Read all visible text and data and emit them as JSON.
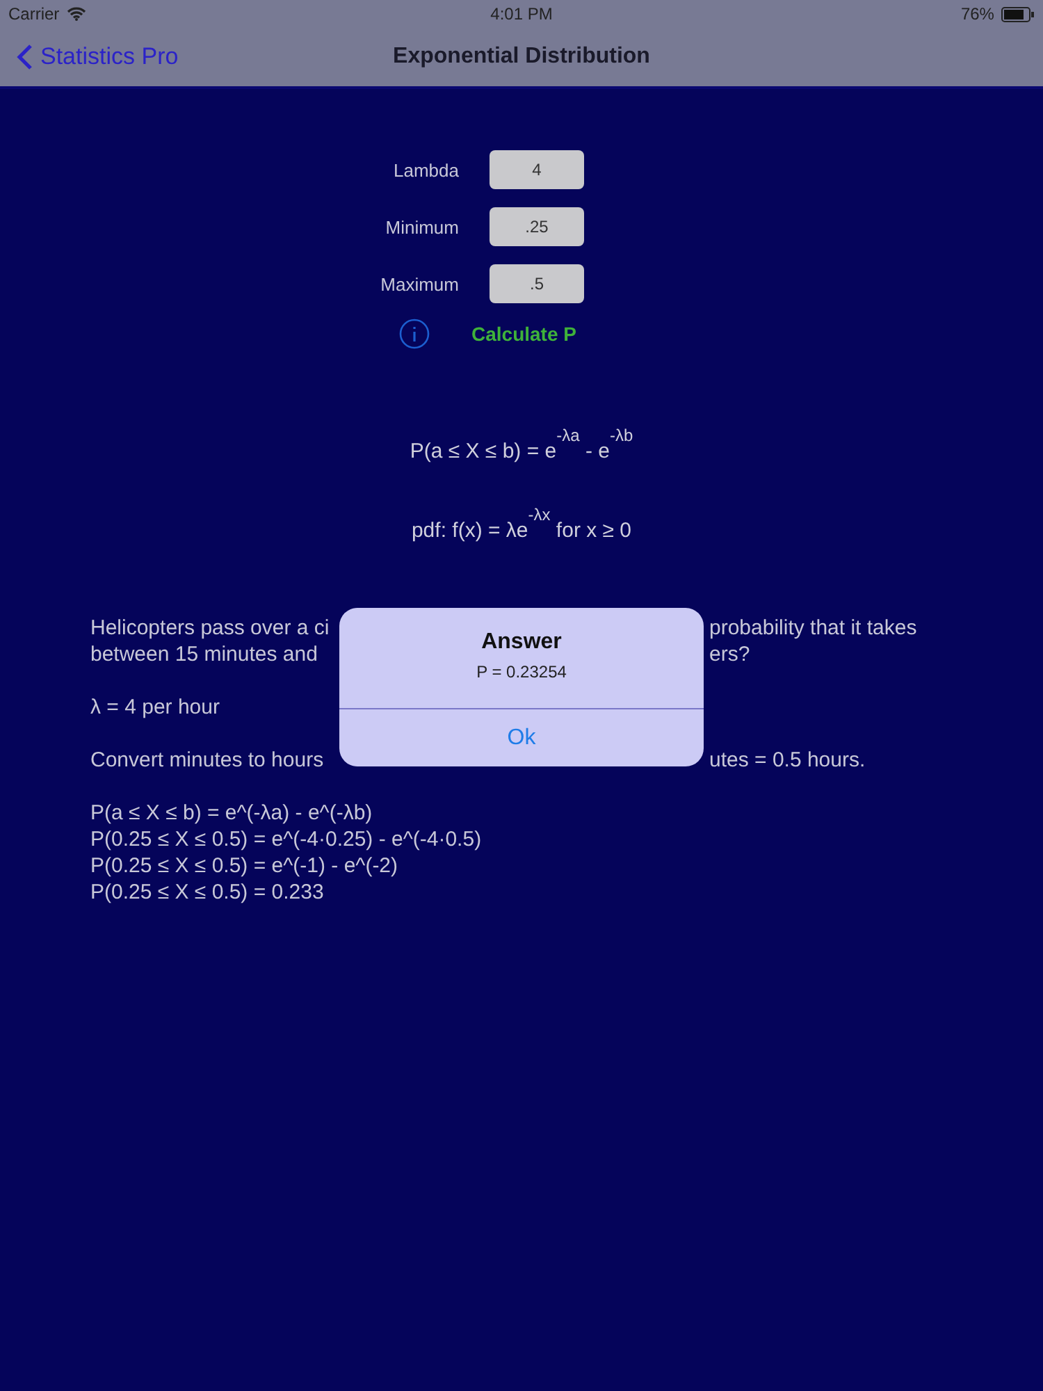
{
  "status_bar": {
    "carrier": "Carrier",
    "time": "4:01 PM",
    "battery": "76%"
  },
  "nav": {
    "back": "Statistics Pro",
    "title": "Exponential Distribution"
  },
  "fields": [
    {
      "label": "Lambda",
      "value": "4"
    },
    {
      "label": "Minimum",
      "value": ".25"
    },
    {
      "label": "Maximum",
      "value": ".5"
    }
  ],
  "calculate_button": "Calculate P",
  "formulas": [
    "P(a ≤ X ≤ b) = e$^{-λa}$ - e$^{-λb}$",
    "pdf:  f(x) = λe$^{-λx}$   for x ≥ 0"
  ],
  "explanation": [
    {
      "lines": [
        {
          "left": "Helicopters pass over a ci",
          "right": "probability that it takes"
        },
        {
          "left": "between 15 minutes and",
          "right": "ers?"
        }
      ]
    },
    {
      "lines": [
        {
          "left": "λ = 4 per hour"
        }
      ]
    },
    {
      "lines": [
        {
          "left": "Convert minutes to hours",
          "right": "utes = 0.5 hours."
        }
      ]
    },
    {
      "lines": [
        {
          "left": "P(a ≤ X ≤ b) = e^(-λa) - e^(-λb)"
        },
        {
          "left": "P(0.25 ≤ X ≤ 0.5) = e^(-4·0.25) - e^(-4·0.5)"
        },
        {
          "left": "P(0.25 ≤ X ≤ 0.5) = e^(-1) - e^(-2)"
        },
        {
          "left": "P(0.25 ≤ X ≤ 0.5) = 0.233"
        }
      ]
    }
  ],
  "alert": {
    "title": "Answer",
    "message": "P = 0.23254",
    "button": "Ok"
  }
}
